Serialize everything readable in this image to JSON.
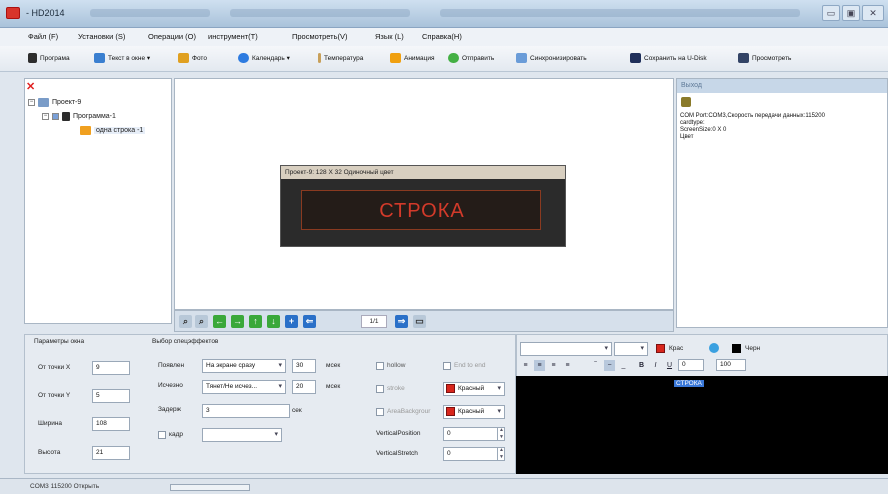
{
  "window": {
    "title": "- HD2014"
  },
  "menu": [
    "Файл (F)",
    "Установки (S)",
    "Операции (O)",
    "инструмент(T)",
    "Просмотреть(V)",
    "Язык (L)",
    "Справка(H)"
  ],
  "toolbar": [
    {
      "label": "Програма",
      "icon": "program-icon"
    },
    {
      "label": "Текст в окне ▾",
      "icon": "text-window-icon"
    },
    {
      "label": "Фото",
      "icon": "photo-icon"
    },
    {
      "label": "Календарь ▾",
      "icon": "calendar-icon"
    },
    {
      "label": "Температура",
      "icon": "thermometer-icon"
    },
    {
      "label": "Анимация",
      "icon": "animation-icon"
    },
    {
      "label": "Отправить",
      "icon": "send-icon"
    },
    {
      "label": "Синхронизировать",
      "icon": "sync-icon"
    },
    {
      "label": "Сохранить на U-Disk",
      "icon": "udisk-icon"
    },
    {
      "label": "Просмотреть",
      "icon": "preview-icon"
    }
  ],
  "tree": {
    "project": "Проект-9",
    "program": "Программа-1",
    "item": "одна строка -1"
  },
  "preview": {
    "header": "Проект-9: 128 X 32 Одиночный цвет",
    "text": "СТРОКА",
    "page": "1/1"
  },
  "output": {
    "header": "Выход",
    "lines": "COM Port:COM3,Скорость передачи данных:115200\ncardtype:\nScreenSize:0 X 0\nЦвет"
  },
  "window_params": {
    "section": "Параметры окна",
    "x_label": "От точки X",
    "x": "9",
    "y_label": "От точки Y",
    "y": "5",
    "w_label": "Ширина",
    "w": "108",
    "h_label": "Высота",
    "h": "21"
  },
  "effects": {
    "section": "Выбор спецэффектов",
    "appear_label": "Появлен",
    "appear_value": "На экране сразу",
    "appear_time": "30",
    "appear_unit": "мсек",
    "disappear_label": "Исчезно",
    "disappear_value": "Тянет/Не исчез...",
    "disappear_time": "20",
    "disappear_unit": "мсек",
    "delay_label": "Задерж",
    "delay_value": "3",
    "delay_unit": "сек",
    "frame_label": "кадр"
  },
  "options": {
    "hollow": "hollow",
    "end_to_end": "End to end",
    "stroke": "stroke",
    "stroke_color": "Красный",
    "area_bg": "AreaBackgrour",
    "area_color": "Красный",
    "vpos_label": "VerticalPosition",
    "vpos": "0",
    "vstretch_label": "VerticalStretch",
    "vstretch": "0"
  },
  "editor": {
    "text_color": "Крас",
    "bg_color": "Черн",
    "bold": "B",
    "italic": "I",
    "underline": "U",
    "size": "0",
    "zoom": "100",
    "content": "СТРОКА"
  },
  "status": {
    "text": "COM3  115200  Открыть"
  },
  "colors": {
    "red": "#d8261c",
    "led": "#d23a2a",
    "highlight": "#3a78d8"
  }
}
